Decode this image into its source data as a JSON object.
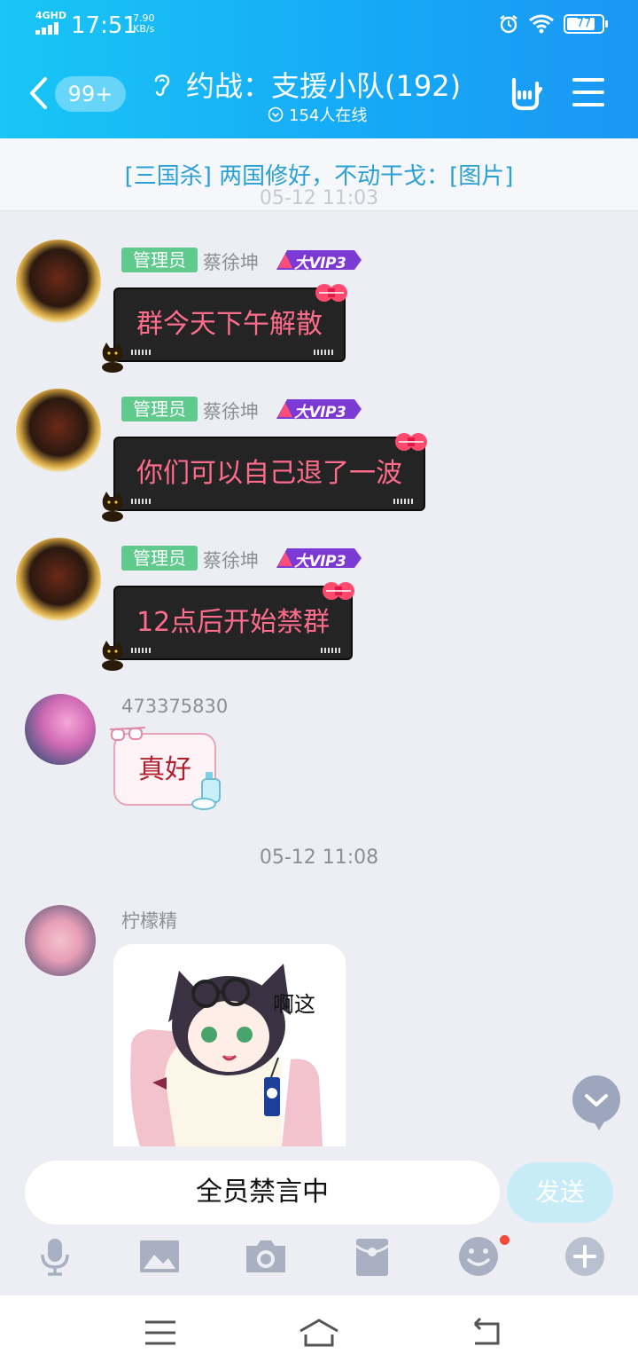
{
  "status_bar": {
    "network": "4GHD",
    "time": "17:51",
    "speed_value": "7.90",
    "speed_unit": "KB/s",
    "battery": "77"
  },
  "header": {
    "unread_count": "99+",
    "title": "约战：支援小队(192)",
    "online": "154人在线"
  },
  "notice": {
    "text": "[三国杀] 两国修好，不动干戈：[图片]",
    "overlap_timestamp": "05-12 11:03"
  },
  "messages": [
    {
      "role": "管理员",
      "sender": "蔡徐坤",
      "vip": "大VIP3",
      "text": "群今天下午解散"
    },
    {
      "role": "管理员",
      "sender": "蔡徐坤",
      "vip": "大VIP3",
      "text": "你们可以自己退了一波"
    },
    {
      "role": "管理员",
      "sender": "蔡徐坤",
      "vip": "大VIP3",
      "text": "12点后开始禁群"
    },
    {
      "sender": "473375830",
      "text": "真好"
    }
  ],
  "time_separator": "05-12 11:08",
  "sticker_message": {
    "sender": "柠檬精",
    "caption": "啊这"
  },
  "input": {
    "muted_text": "全员禁言中",
    "send_label": "发送"
  },
  "toolbar_icons": [
    "microphone-icon",
    "image-icon",
    "camera-icon",
    "red-packet-icon",
    "emoji-icon",
    "plus-icon"
  ],
  "colors": {
    "header_start": "#19c6f5",
    "header_end": "#1b97f3",
    "admin_badge": "#5fca8c",
    "bubble_text": "#ff6d8b",
    "notice_text": "#2aa0d6"
  }
}
